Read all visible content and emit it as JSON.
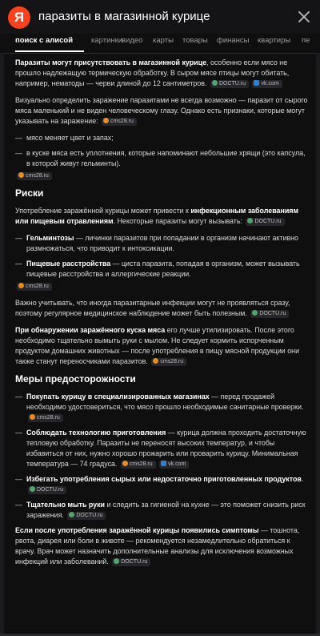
{
  "header": {
    "logo_letter": "Я",
    "query": "паразиты в магазинной курице",
    "close_icon": "close-icon"
  },
  "tabs": [
    {
      "label": "поиск с алисой",
      "active": true
    },
    {
      "label": "картинки"
    },
    {
      "label": "видео"
    },
    {
      "label": "карты"
    },
    {
      "label": "товары"
    },
    {
      "label": "финансы"
    },
    {
      "label": "квартиры"
    },
    {
      "label": "пе"
    }
  ],
  "sources": {
    "docs": "DOCTU.ru",
    "vk": "vk.com",
    "cms": "cms28.ru"
  },
  "article": {
    "p1_bold": "Паразиты могут присутствовать в магазинной курице",
    "p1_text": ", особенно если мясо не прошло надлежащую термическую обработку. В сыром мясе птицы могут обитать, например, нематоды — черви длиной до 12 сантиметров.",
    "p2": "Визуально определить заражение паразитами не всегда возможно — паразит от сырого мяса маленький и не виден человеческому глазу. Однако есть признаки, которые могут указывать на заражение:",
    "signs": [
      "мясо меняет цвет и запах;",
      "в куске мяса есть уплотнения, которые напоминают небольшие хрящи (это капсула, в которой живут гельминты)."
    ],
    "risks_title": "Риски",
    "risks_intro_a": "Употребление заражённой курицы может привести к ",
    "risks_intro_bold": "инфекционным заболеваниям или пищевым отравлениям",
    "risks_intro_b": ". Некоторые паразиты могут вызывать:",
    "risks": [
      {
        "bold": "Гельминтозы",
        "text": " — личинки паразитов при попадании в организм начинают активно размножаться, что приводит к интоксикации."
      },
      {
        "bold": "Пищевые расстройства",
        "text": " — циста паразита, попадая в организм, может вызывать пищевые расстройства и аллергические реакции."
      }
    ],
    "p_warn": "Важно учитывать, что иногда паразитарные инфекции могут не проявляться сразу, поэтому регулярное медицинское наблюдение может быть полезным.",
    "p_dispose_bold": "При обнаружении заражённого куска мяса",
    "p_dispose_text": " его лучше утилизировать. После этого необходимо тщательно вымыть руки с мылом. Не следует кормить испорченным продуктом домашних животных — после употребления в пищу мясной продукции они также станут переносчиками паразитов.",
    "measures_title": "Меры предосторожности",
    "measures": [
      {
        "bold": "Покупать курицу в специализированных магазинах",
        "text": " — перед продажей необходимо удостовериться, что мясо прошло необходимые санитарные проверки."
      },
      {
        "bold": "Соблюдать технологию приготовления",
        "text": " — курица должна проходить достаточную тепловую обработку. Паразиты не переносят высоких температур, и чтобы избавиться от них, нужно хорошо прожарить или проварить курицу. Минимальная температура — 74 градуса."
      },
      {
        "bold": "Избегать употребления сырых или недостаточно приготовленных продуктов",
        "text": "."
      },
      {
        "bold": "Тщательно мыть руки",
        "text": " и следить за гигиеной на кухне — это поможет снизить риск заражения."
      }
    ],
    "p_final_bold": "Если после употребления заражённой курицы появились симптомы",
    "p_final_text": " — тошнота, рвота, диарея или боли в животе — рекомендуется незамедлительно обратиться к врачу. Врач может назначить дополнительные анализы для исключения возможных инфекций или заболеваний."
  }
}
